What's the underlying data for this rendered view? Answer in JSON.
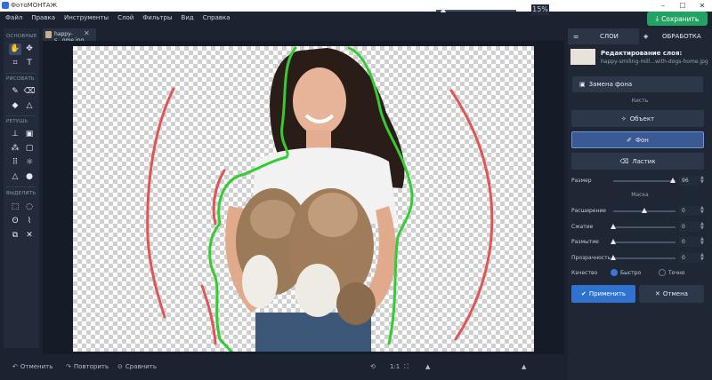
{
  "window": {
    "title": "ФотоМОНТАЖ"
  },
  "menu": [
    "Файл",
    "Правка",
    "Инструменты",
    "Слой",
    "Фильтры",
    "Вид",
    "Справка"
  ],
  "save_label": "Сохранить",
  "toolbox": {
    "sections": [
      "ОСНОВНЫЕ",
      "РИСОВАТЬ",
      "РЕТУШЬ",
      "ВЫДЕЛИТЬ"
    ]
  },
  "document": {
    "tab_name": "happy-s...ome.jpg"
  },
  "bottom": {
    "undo": "Отменить",
    "redo": "Повторить",
    "compare": "Сравнить",
    "ratio": "1:1",
    "zoom": "15%"
  },
  "panel": {
    "tab_layers": "СЛОИ",
    "tab_processing": "ОБРАБОТКА",
    "layer_title": "Редактирование слоя:",
    "layer_file": "happy-smiling-mill...with-dogs-home.jpg",
    "replace_bg": "Замена фона",
    "brush_title": "Кисть",
    "btn_object": "Объект",
    "btn_background": "Фон",
    "btn_eraser": "Ластик",
    "size_label": "Размер",
    "size_value": "96",
    "mask_title": "Маска",
    "expand_label": "Расширение",
    "expand_value": "0",
    "shrink_label": "Сжатие",
    "shrink_value": "0",
    "blur_label": "Размытие",
    "blur_value": "0",
    "transparency_label": "Прозрачность",
    "transparency_value": "0",
    "quality_label": "Качество",
    "quality_fast": "Быстро",
    "quality_precise": "Точно",
    "apply": "Применить",
    "cancel": "Отмена"
  },
  "colors": {
    "accent_green": "#22a363",
    "accent_blue": "#2f72d0",
    "stroke_red": "#e05555",
    "stroke_green": "#33cc33"
  }
}
